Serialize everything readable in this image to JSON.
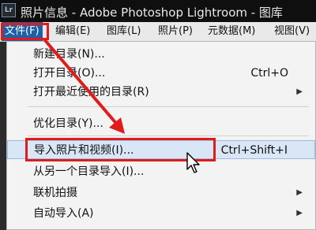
{
  "titlebar": {
    "app_icon_text": "Lr",
    "title": "照片信息 - Adobe Photoshop Lightroom - 图库"
  },
  "menubar": {
    "items": [
      {
        "label": "文件(F)"
      },
      {
        "label": "编辑(E)"
      },
      {
        "label": "图库(L)"
      },
      {
        "label": "照片(P)"
      },
      {
        "label": "元数据(M)"
      },
      {
        "label": "视图(V)"
      }
    ]
  },
  "file_menu": {
    "items": [
      {
        "label": "新建目录(N)...",
        "shortcut": ""
      },
      {
        "label": "打开目录(O)...",
        "shortcut": "Ctrl+O"
      },
      {
        "label": "打开最近使用的目录(R)",
        "shortcut": ""
      },
      {
        "label": "优化目录(Y)...",
        "shortcut": ""
      },
      {
        "label": "导入照片和视频(I)...",
        "shortcut": "Ctrl+Shift+I"
      },
      {
        "label": "从另一个目录导入(I)...",
        "shortcut": ""
      },
      {
        "label": "联机拍摄",
        "shortcut": ""
      },
      {
        "label": "自动导入(A)",
        "shortcut": ""
      }
    ]
  },
  "colors": {
    "highlight_box": "#e01b1b",
    "menu_active": "#1f5fa8"
  },
  "icons": {
    "submenu_arrow": "triangle-right",
    "cursor": "arrow-pointer"
  }
}
